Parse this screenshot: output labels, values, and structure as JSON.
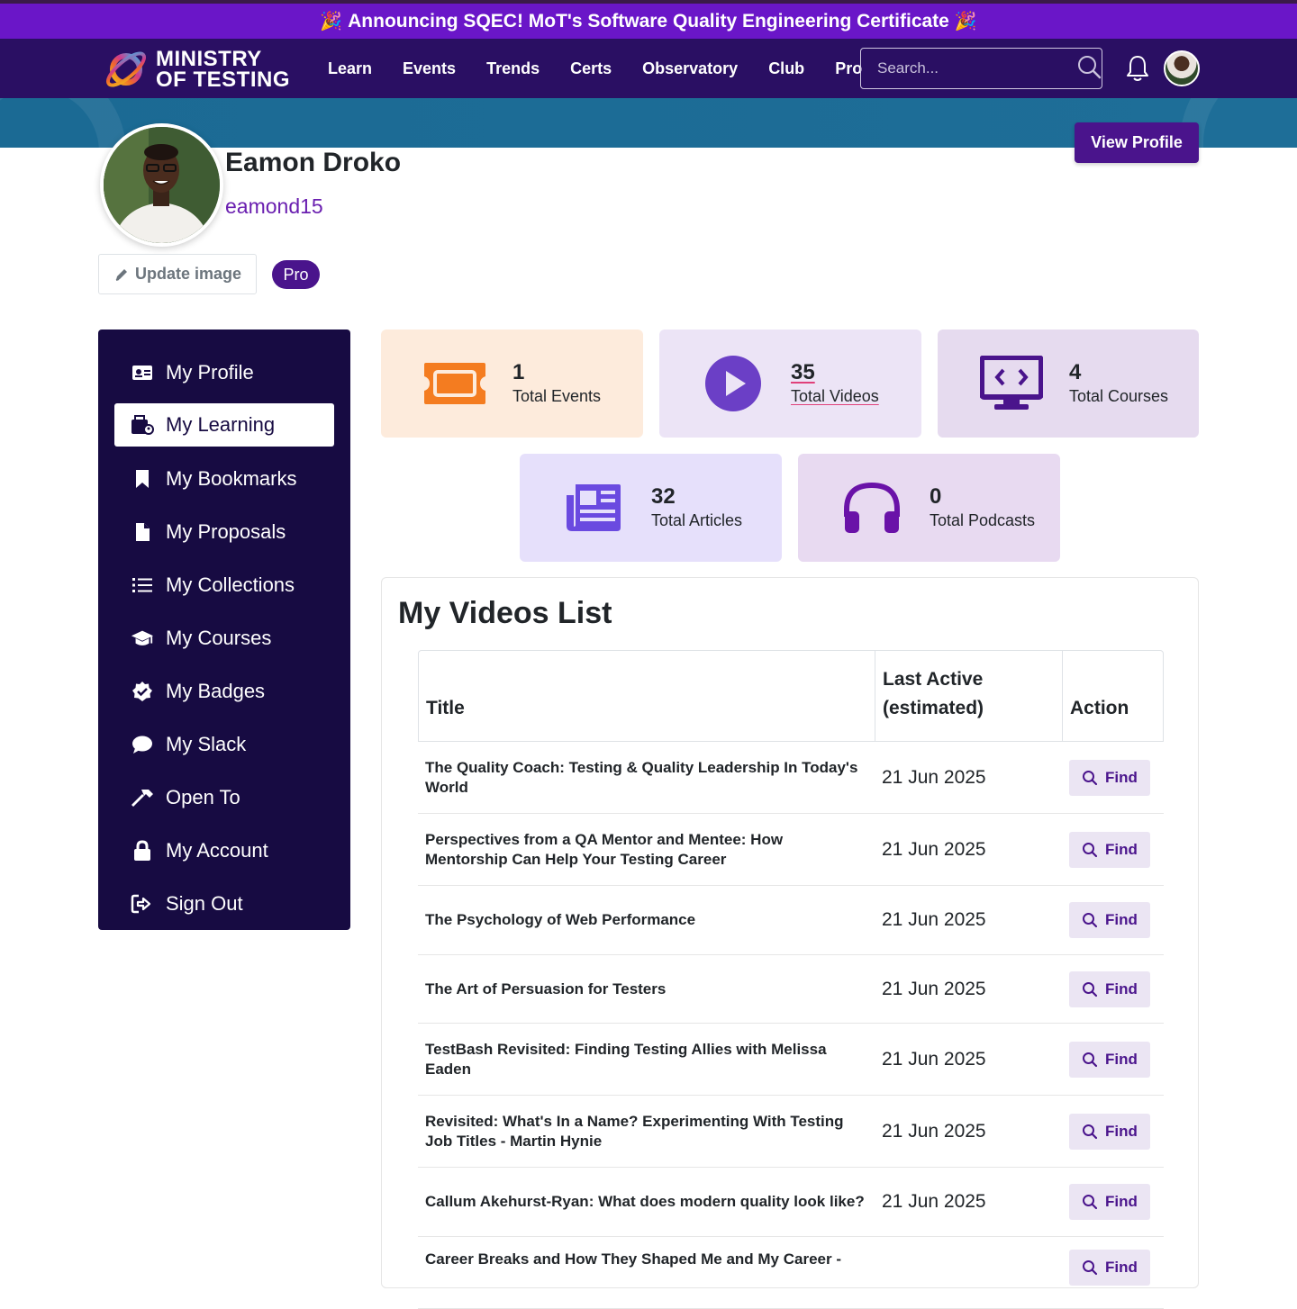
{
  "announcement": {
    "text": "Announcing SQEC! MoT's Software Quality Engineering Certificate",
    "emoji": "🎉"
  },
  "nav": {
    "logo_line1": "MINISTRY",
    "logo_line2": "OF TESTING",
    "links": [
      "Learn",
      "Events",
      "Trends",
      "Certs",
      "Observatory",
      "Club",
      "Pro"
    ],
    "search_placeholder": "Search..."
  },
  "profile": {
    "name": "Eamon Droko",
    "handle": "eamond15",
    "view_profile_label": "View Profile",
    "update_image_label": "Update image",
    "badge": "Pro"
  },
  "sidebar": {
    "items": [
      {
        "label": "My Profile",
        "icon": "id-card-icon"
      },
      {
        "label": "My Learning",
        "icon": "learning-icon",
        "active": true
      },
      {
        "label": "My Bookmarks",
        "icon": "bookmark-icon"
      },
      {
        "label": "My Proposals",
        "icon": "file-icon"
      },
      {
        "label": "My Collections",
        "icon": "list-icon"
      },
      {
        "label": "My Courses",
        "icon": "graduation-cap-icon"
      },
      {
        "label": "My Badges",
        "icon": "badge-check-icon"
      },
      {
        "label": "My Slack",
        "icon": "chat-icon"
      },
      {
        "label": "Open To",
        "icon": "hammer-icon"
      },
      {
        "label": "My Account",
        "icon": "lock-icon"
      },
      {
        "label": "Sign Out",
        "icon": "sign-out-icon"
      }
    ]
  },
  "stats": {
    "events": {
      "value": "1",
      "label": "Total Events",
      "icon": "ticket-icon",
      "bg": "#fdebdc",
      "color": "#f47c20"
    },
    "videos": {
      "value": "35",
      "label": "Total Videos",
      "icon": "play-circle-icon",
      "bg": "#ece4f6",
      "color": "#6b3fc6"
    },
    "courses": {
      "value": "4",
      "label": "Total Courses",
      "icon": "monitor-code-icon",
      "bg": "#e6dbef",
      "color": "#4a148c"
    },
    "articles": {
      "value": "32",
      "label": "Total Articles",
      "icon": "newspaper-icon",
      "bg": "#e6e0fb",
      "color": "#6a4ae0"
    },
    "podcasts": {
      "value": "0",
      "label": "Total Podcasts",
      "icon": "headphones-icon",
      "bg": "#e8daf1",
      "color": "#6a12a8"
    }
  },
  "videos": {
    "title": "My Videos List",
    "headers": {
      "title": "Title",
      "last_active": "Last Active (estimated)",
      "action": "Action"
    },
    "find_label": "Find",
    "rows": [
      {
        "title": "The Quality Coach: Testing & Quality Leadership In Today's World",
        "date": "21 Jun 2025"
      },
      {
        "title": "Perspectives from a QA Mentor and Mentee: How Mentorship Can Help Your Testing Career",
        "date": "21 Jun 2025"
      },
      {
        "title": "The Psychology of Web Performance",
        "date": "21 Jun 2025"
      },
      {
        "title": "The Art of Persuasion for Testers",
        "date": "21 Jun 2025"
      },
      {
        "title": "TestBash Revisited: Finding Testing Allies with Melissa Eaden",
        "date": "21 Jun 2025"
      },
      {
        "title": "Revisited: What's In a Name? Experimenting With Testing Job Titles - Martin Hynie",
        "date": "21 Jun 2025"
      },
      {
        "title": "Callum Akehurst-Ryan: What does modern quality look like?",
        "date": "21 Jun 2025"
      },
      {
        "title": "Career Breaks and How They Shaped Me and My Career -",
        "date": ""
      }
    ]
  }
}
